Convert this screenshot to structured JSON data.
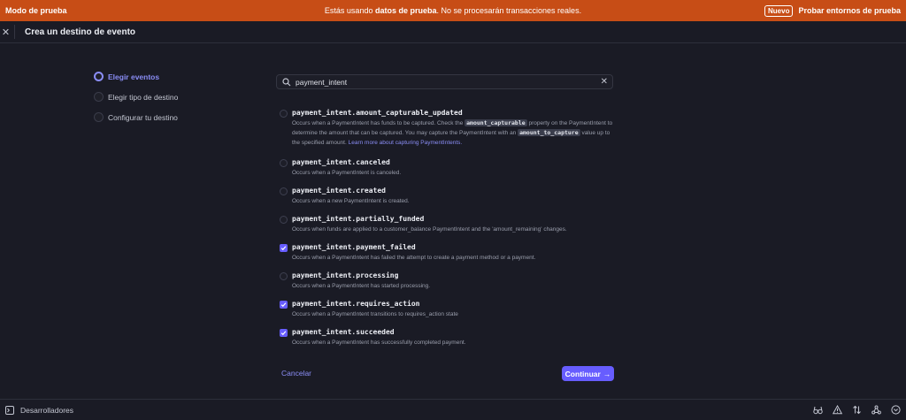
{
  "banner": {
    "mode_label": "Modo de prueba",
    "message_prefix": "Estás usando ",
    "message_bold": "datos de prueba",
    "message_suffix": ". No se procesarán transacciones reales.",
    "new_badge": "Nuevo",
    "link": "Probar entornos de prueba",
    "color": "#c74d16"
  },
  "header": {
    "close_icon": "close-icon",
    "title": "Crea un destino de evento"
  },
  "steps": [
    {
      "label": "Elegir eventos",
      "active": true
    },
    {
      "label": "Elegir tipo de destino",
      "active": false
    },
    {
      "label": "Configurar tu destino",
      "active": false
    }
  ],
  "search": {
    "value": "payment_intent",
    "icon": "search-icon",
    "clear_icon": "close-icon"
  },
  "events": [
    {
      "name": "payment_intent.amount_capturable_updated",
      "checked": false,
      "desc_parts": [
        {
          "t": "Occurs when a PaymentIntent has funds to be captured. Check the "
        },
        {
          "code": "amount_capturable"
        },
        {
          "t": " property on the PaymentIntent to determine the amount that can be captured. You may capture the PaymentIntent with an "
        },
        {
          "code": "amount_to_capture"
        },
        {
          "t": " value up to the specified amount. "
        },
        {
          "link": "Learn more about capturing PaymentIntents."
        }
      ]
    },
    {
      "name": "payment_intent.canceled",
      "checked": false,
      "desc": "Occurs when a PaymentIntent is canceled."
    },
    {
      "name": "payment_intent.created",
      "checked": false,
      "desc": "Occurs when a new PaymentIntent is created."
    },
    {
      "name": "payment_intent.partially_funded",
      "checked": false,
      "desc": "Occurs when funds are applied to a customer_balance PaymentIntent and the 'amount_remaining' changes."
    },
    {
      "name": "payment_intent.payment_failed",
      "checked": true,
      "desc": "Occurs when a PaymentIntent has failed the attempt to create a payment method or a payment."
    },
    {
      "name": "payment_intent.processing",
      "checked": false,
      "desc": "Occurs when a PaymentIntent has started processing."
    },
    {
      "name": "payment_intent.requires_action",
      "checked": true,
      "desc": "Occurs when a PaymentIntent transitions to requires_action state"
    },
    {
      "name": "payment_intent.succeeded",
      "checked": true,
      "desc": "Occurs when a PaymentIntent has successfully completed payment."
    }
  ],
  "actions": {
    "cancel": "Cancelar",
    "continue": "Continuar",
    "continue_icon": "arrow-right-icon"
  },
  "footer": {
    "label": "Desarrolladores",
    "terminal_icon": "terminal-icon",
    "icons": [
      "binoculars-icon",
      "warning-icon",
      "sort-arrows-icon",
      "webhook-icon",
      "chevron-down-circle-icon"
    ]
  },
  "colors": {
    "accent": "#675dff",
    "accent_text": "#8a8df5",
    "background": "#1a1b25"
  }
}
